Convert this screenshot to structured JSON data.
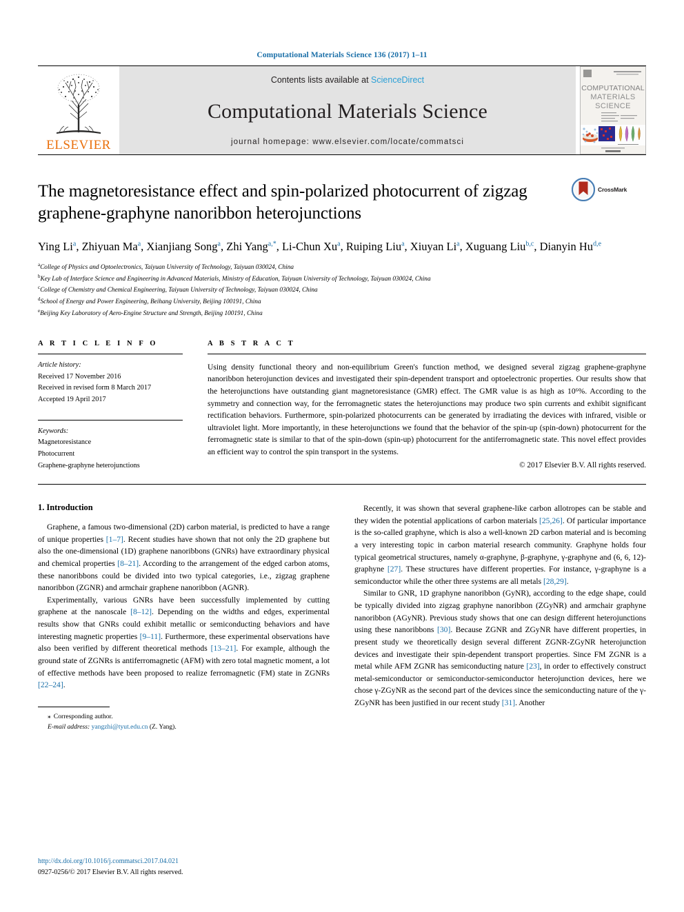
{
  "running_head": "Computational Materials Science 136 (2017) 1–11",
  "masthead": {
    "contents_prefix": "Contents lists available at ",
    "sciencedirect": "ScienceDirect",
    "journal_title": "Computational Materials Science",
    "homepage": "journal homepage: www.elsevier.com/locate/commatsci",
    "publisher": "ELSEVIER",
    "cover_title_line1": "COMPUTATIONAL",
    "cover_title_line2": "MATERIALS",
    "cover_title_line3": "SCIENCE"
  },
  "article": {
    "title": "The magnetoresistance effect and spin-polarized photocurrent of zigzag graphene-graphyne nanoribbon heterojunctions",
    "crossmark_label": "CrossMark",
    "authors": [
      {
        "name": "Ying Li",
        "sup": "a"
      },
      {
        "name": "Zhiyuan Ma",
        "sup": "a"
      },
      {
        "name": "Xianjiang Song",
        "sup": "a"
      },
      {
        "name": "Zhi Yang",
        "sup": "a,*"
      },
      {
        "name": "Li-Chun Xu",
        "sup": "a"
      },
      {
        "name": "Ruiping Liu",
        "sup": "a"
      },
      {
        "name": "Xiuyan Li",
        "sup": "a"
      },
      {
        "name": "Xuguang Liu",
        "sup": "b,c"
      },
      {
        "name": "Dianyin Hu",
        "sup": "d,e"
      }
    ],
    "affiliations": [
      {
        "marker": "a",
        "text": "College of Physics and Optoelectronics, Taiyuan University of Technology, Taiyuan 030024, China"
      },
      {
        "marker": "b",
        "text": "Key Lab of Interface Science and Engineering in Advanced Materials, Ministry of Education, Taiyuan University of Technology, Taiyuan 030024, China"
      },
      {
        "marker": "c",
        "text": "College of Chemistry and Chemical Engineering, Taiyuan University of Technology, Taiyuan 030024, China"
      },
      {
        "marker": "d",
        "text": "School of Energy and Power Engineering, Beihang University, Beijing 100191, China"
      },
      {
        "marker": "e",
        "text": "Beijing Key Laboratory of Aero-Engine Structure and Strength, Beijing 100191, China"
      }
    ]
  },
  "article_info": {
    "section_label": "A R T I C L E   I N F O",
    "history_label": "Article history:",
    "history": [
      "Received 17 November 2016",
      "Received in revised form 8 March 2017",
      "Accepted 19 April 2017"
    ],
    "keywords_label": "Keywords:",
    "keywords": [
      "Magnetoresistance",
      "Photocurrent",
      "Graphene-graphyne heterojunctions"
    ]
  },
  "abstract": {
    "section_label": "A B S T R A C T",
    "text": "Using density functional theory and non-equilibrium Green's function method, we designed several zigzag graphene-graphyne nanoribbon heterojunction devices and investigated their spin-dependent transport and optoelectronic properties. Our results show that the heterojunctions have outstanding giant magnetoresistance (GMR) effect. The GMR value is as high as 10⁶%. According to the symmetry and connection way, for the ferromagnetic states the heterojunctions may produce two spin currents and exhibit significant rectification behaviors. Furthermore, spin-polarized photocurrents can be generated by irradiating the devices with infrared, visible or ultraviolet light. More importantly, in these heterojunctions we found that the behavior of the spin-up (spin-down) photocurrent for the ferromagnetic state is similar to that of the spin-down (spin-up) photocurrent for the antiferromagnetic state. This novel effect provides an efficient way to control the spin transport in the systems.",
    "copyright": "© 2017 Elsevier B.V. All rights reserved."
  },
  "introduction": {
    "heading": "1. Introduction",
    "left_paragraphs": [
      "Graphene, a famous two-dimensional (2D) carbon material, is predicted to have a range of unique properties [1–7]. Recent studies have shown that not only the 2D graphene but also the one-dimensional (1D) graphene nanoribbons (GNRs) have extraordinary physical and chemical properties [8–21]. According to the arrangement of the edged carbon atoms, these nanoribbons could be divided into two typical categories, i.e., zigzag graphene nanoribbon (ZGNR) and armchair graphene nanoribbon (AGNR).",
      "Experimentally, various GNRs have been successfully implemented by cutting graphene at the nanoscale [8–12]. Depending on the widths and edges, experimental results show that GNRs could exhibit metallic or semiconducting behaviors and have interesting magnetic properties [9–11]. Furthermore, these experimental observations have also been verified by different theoretical methods [13–21]. For example, although the ground state of ZGNRs is antiferromagnetic (AFM) with zero total magnetic moment, a lot of effective methods have been proposed to realize ferromagnetic (FM) state in ZGNRs [22–24]."
    ],
    "right_paragraphs": [
      "Recently, it was shown that several graphene-like carbon allotropes can be stable and they widen the potential applications of carbon materials [25,26]. Of particular importance is the so-called graphyne, which is also a well-known 2D carbon material and is becoming a very interesting topic in carbon material research community. Graphyne holds four typical geometrical structures, namely α-graphyne, β-graphyne, γ-graphyne and (6, 6, 12)-graphyne [27]. These structures have different properties. For instance, γ-graphyne is a semiconductor while the other three systems are all metals [28,29].",
      "Similar to GNR, 1D graphyne nanoribbon (GyNR), according to the edge shape, could be typically divided into zigzag graphyne nanoribbon (ZGyNR) and armchair graphyne nanoribbon (AGyNR). Previous study shows that one can design different heterojunctions using these nanoribbons [30]. Because ZGNR and ZGyNR have different properties, in present study we theoretically design several different ZGNR-ZGyNR heterojunction devices and investigate their spin-dependent transport properties. Since FM ZGNR is a metal while AFM ZGNR has semiconducting nature [23], in order to effectively construct metal-semiconductor or semiconductor-semiconductor heterojunction devices, here we chose γ-ZGyNR as the second part of the devices since the semiconducting nature of the γ-ZGyNR has been justified in our recent study [31]. Another"
    ]
  },
  "footnote": {
    "star": "⁎",
    "corresponding": "Corresponding author.",
    "email_label": "E-mail address:",
    "email": "yangzhi@tyut.edu.cn",
    "email_owner": "(Z. Yang)."
  },
  "footer": {
    "doi": "http://dx.doi.org/10.1016/j.commatsci.2017.04.021",
    "issn_line": "0927-0256/© 2017 Elsevier B.V. All rights reserved."
  },
  "colors": {
    "link": "#1a6fa8",
    "sciencedirect": "#2a9fd6",
    "elsevier_orange": "#ea700d",
    "masthead_bg": "#e3e3e3"
  }
}
